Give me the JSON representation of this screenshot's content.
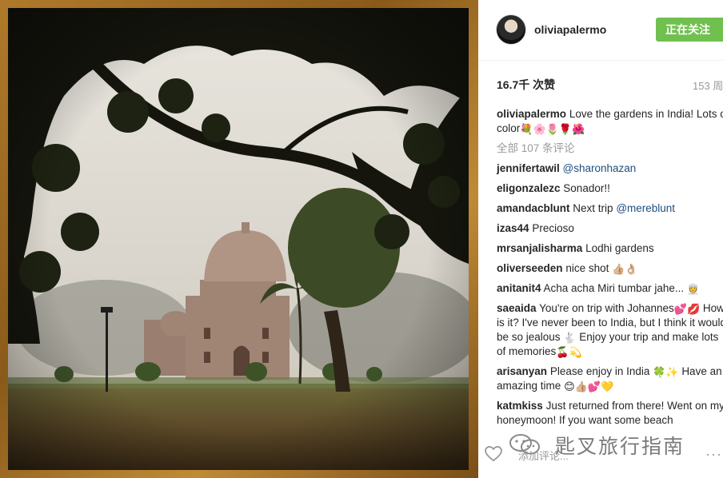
{
  "post": {
    "username": "oliviapalermo",
    "follow_label": "正在关注",
    "likes": "16.7千 次赞",
    "time": "153 周",
    "caption": {
      "user": "oliviapalermo",
      "text": "Love the gardens in India! Lots of color"
    },
    "view_all": "全部 107 条评论",
    "comments": [
      {
        "user": "jennifertawil",
        "text": "",
        "mention": "@sharonhazan"
      },
      {
        "user": "eligonzalezc",
        "text": "Sonador!!",
        "mention": ""
      },
      {
        "user": "amandacblunt",
        "text": "Next trip",
        "mention": "@mereblunt"
      },
      {
        "user": "izas44",
        "text": "Precioso",
        "mention": ""
      },
      {
        "user": "mrsanjalisharma",
        "text": "Lodhi gardens",
        "mention": ""
      },
      {
        "user": "oliverseeden",
        "text": "nice shot",
        "mention": ""
      },
      {
        "user": "anitanit4",
        "text": "Acha acha Miri tumbar jahe...",
        "mention": ""
      },
      {
        "user": "saeaida",
        "text": "You're on trip with Johannes",
        "mention": ""
      },
      {
        "user": "arisanyan",
        "text": "Please enjoy in India",
        "mention": ""
      },
      {
        "user": "katmkiss",
        "text": "Just returned from there! Went on my honeymoon! If you want some beach",
        "mention": ""
      }
    ],
    "saeaida_more": "How is it? I've never been to India, but I think it would be so jealous",
    "saeaida_tail": "Enjoy your trip and make lots of memories",
    "arisanyan_tail1": "Have",
    "arisanyan_tail2": "an amazing time",
    "comment_placeholder": "添加评论...",
    "more_label": "···"
  },
  "watermark": {
    "text": "匙叉旅行指南"
  },
  "colors": {
    "follow": "#70c050",
    "mention": "#1d4f7e",
    "frame": "#a87028"
  },
  "icons": [
    "heart-icon",
    "more-icon",
    "avatar"
  ]
}
